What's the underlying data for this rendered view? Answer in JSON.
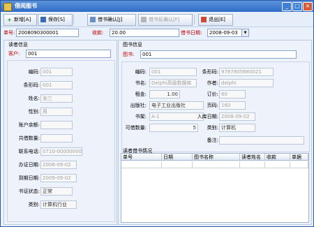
{
  "window": {
    "title": "借阅图书"
  },
  "toolbar": {
    "new_label": "新增[A]",
    "save_label": "保存[S]",
    "confirm_label": "借书确认[J]",
    "cancel_confirm_label": "借书反确认[F]",
    "exit_label": "退出[E]"
  },
  "header": {
    "order_label": "单号:",
    "order_value": "2008090300001",
    "fee_label": "收款:",
    "fee_value": "20.00",
    "date_label": "借书日期:",
    "date_value": "2008-09-03"
  },
  "reader": {
    "title": "读者信息",
    "customer_label": "客户:",
    "customer_value": "001",
    "fields": [
      {
        "label": "编码:",
        "value": "001"
      },
      {
        "label": "条形码:",
        "value": "001"
      },
      {
        "label": "姓名:",
        "value": "张三"
      },
      {
        "label": "性别:",
        "value": "男"
      },
      {
        "label": "账户余额:",
        "value": ""
      },
      {
        "label": "共借数量:",
        "value": ""
      },
      {
        "label": "联系电话:",
        "value": "0710-00000000"
      },
      {
        "label": "办证日期:",
        "value": "2008-09-02"
      },
      {
        "label": "到期日期:",
        "value": "2009-09-02"
      },
      {
        "label": "书证状态:",
        "value": "正常"
      },
      {
        "label": "类别:",
        "value": "计算机行业"
      }
    ]
  },
  "book": {
    "title": "图书信息",
    "book_label": "图书:",
    "book_value": "001",
    "code_label": "编码:",
    "code_value": "001",
    "barcode_label": "条形码:",
    "barcode_value": "9787805680021",
    "name_label": "书名:",
    "name_value": "Delphi高级数据库",
    "author_label": "作者:",
    "author_value": "delphi",
    "rent_label": "租金:",
    "rent_value": "1.00",
    "price_label": "订价:",
    "price_value": "60",
    "publisher_label": "出版社:",
    "publisher_value": "电子工业出版社",
    "pages_label": "页码:",
    "pages_value": "160",
    "shelf_label": "书架:",
    "shelf_value": "A-1",
    "stockin_label": "入库日期:",
    "stockin_value": "2008-09-02",
    "qty_label": "可借数量:",
    "qty_value": "5",
    "category_label": "类别:",
    "category_value": "计算机",
    "remark_label": "备注:",
    "remark_value": ""
  },
  "history": {
    "title": "读者借书情况",
    "columns": [
      "单号",
      "日期",
      "图书名称",
      "读者姓名",
      "收款",
      "单据"
    ]
  }
}
